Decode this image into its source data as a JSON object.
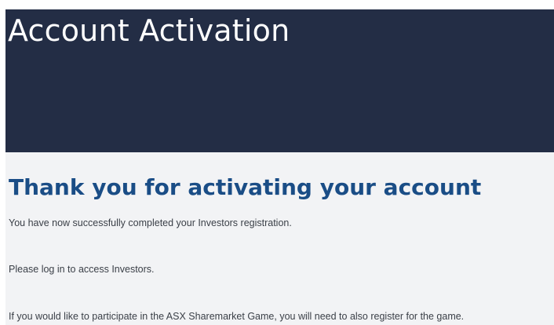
{
  "hero": {
    "title": "Account Activation"
  },
  "main": {
    "heading": "Thank you for activating your account",
    "paragraphs": [
      "You have now successfully completed your Investors registration.",
      "Please log in to access Investors.",
      "If you would like to participate in the ASX Sharemarket Game, you will need to also register for the game."
    ]
  },
  "colors": {
    "hero_background": "#232d45",
    "heading": "#1a4d86",
    "content_background": "#f2f3f5"
  }
}
